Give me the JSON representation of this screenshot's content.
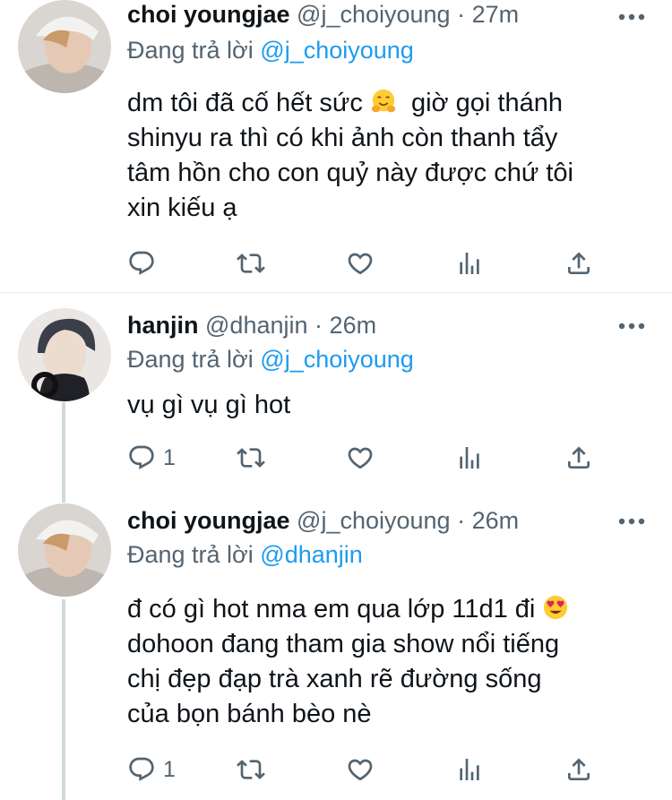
{
  "tweets": [
    {
      "name": "choi youngjae",
      "handle": "@j_choiyoung",
      "sep": "·",
      "time": "27m",
      "replying_prefix": "Đang trả lời",
      "replying_to": "@j_choiyoung",
      "text_a": "dm tôi đã cố hết sức",
      "emoji": "hugging-face",
      "text_b": "  giờ gọi thánh\nshinyu ra thì có khi ảnh còn thanh tẩy\ntâm hồn cho con quỷ này được chứ tôi\nxin kiếu ạ",
      "reply_count": "",
      "avatar": "avatar-choi-youngjae"
    },
    {
      "name": "hanjin",
      "handle": "@dhanjin",
      "sep": "·",
      "time": "26m",
      "replying_prefix": "Đang trả lời",
      "replying_to": "@j_choiyoung",
      "text": "vụ gì vụ gì hot",
      "reply_count": "1",
      "avatar": "avatar-hanjin"
    },
    {
      "name": "choi youngjae",
      "handle": "@j_choiyoung",
      "sep": "·",
      "time": "26m",
      "replying_prefix": "Đang trả lời",
      "replying_to": "@dhanjin",
      "text_a": "đ có gì hot nma em qua lớp 11d1 đi",
      "emoji": "heart-eyes",
      "text_b": "\ndohoon đang tham gia show nổi tiếng\nchị đẹp đạp trà xanh rẽ đường sống\ncủa bọn bánh bèo nè",
      "reply_count": "1",
      "avatar": "avatar-choi-youngjae"
    }
  ],
  "colors": {
    "link": "#1d9bf0",
    "muted": "#536471",
    "text": "#0f1419",
    "thread_line": "#cfd9de"
  },
  "icons": [
    "reply-icon",
    "retweet-icon",
    "like-icon",
    "analytics-icon",
    "share-icon",
    "more-icon"
  ]
}
